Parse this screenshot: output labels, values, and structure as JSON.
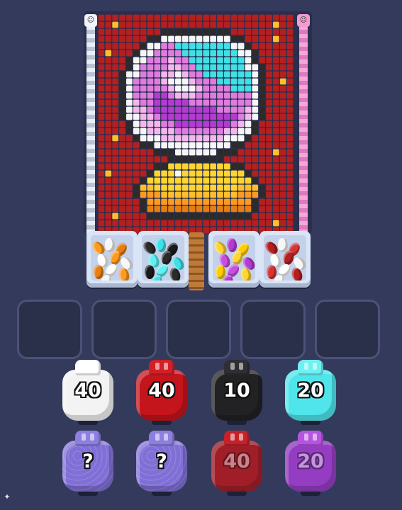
{
  "colors": {
    "background": "#343a5c",
    "pixel_palette": {
      "R": "#b51f1f",
      "r": "#d83434",
      "K": "#2b2b2b",
      "W": "#f6f6f6",
      "C": "#3fe0e6",
      "P": "#e07be0",
      "M": "#b33bd1",
      "L": "#f4b7ec",
      "Y": "#ffd530",
      "O": "#ff9a20",
      "o": "#e67e12",
      "G": "#ffbe2a"
    }
  },
  "pixel_art": {
    "cols": 28,
    "rows": 31,
    "grid": [
      "RRRRRRRRRRRRRRRRRRRRRRRRRRRR",
      "RRGRRRRRRRRRRRRRRRRRRRRRRGRR",
      "RRRRRRRRRKKKKKKKKKKRRRRRRRRR",
      "RRRRRRRKKWWWWWWWWWWKKRRRRGRR",
      "RRRRRRKWWPPCCCCCCCCWWKRRRRRR",
      "RGRRRKWWPPPPCCCCCCCCWWKRRRRR",
      "RRRRKWWPPPLPPCCCCCCCCWKRRRRR",
      "RRRRKWPPPPLLPPCCCCCCCWWKRRRR",
      "RRRKWWPPPLLWLPPCCCCCCCWKRRRR",
      "RRRKWPPPPLWWWLPPPCCCCCWKRRGR",
      "RRRKWPPPPPLWWWLPPPPCCCWKRRRR",
      "RRRKWPPPMMPLLLPPPPPPPPWKRRRR",
      "RRRKWLPPMMMMMPPPPPPPPPWKRRRR",
      "RRRKWLLPMMMMMMMMMPPPPLWKRRRR",
      "RRRKWWLLPMMMMMMMMMMMPLWKRRRR",
      "RRRRKWLLLPPMMMMMMMMPLWKRRRRR",
      "RRRRKWWLLLLPPPPPPPLLWWKRRRRR",
      "RRGRRKWWWLLLLLLLLLWWWKRRRRRR",
      "RRRRRRKKWWWWWWWWWWWKKRRRRRRR",
      "RRRRRRRRKKKWWWWWWKKKRRRRRGRR",
      "RRRRRRRRRRKKKKKKKKRRRRRRRRRR",
      "RRRRRRRRKKYYYYYYYYYKKRRRRRRR",
      "RGRRRRRKYYYWYYYYYYYYYKRRRRRR",
      "RRRRRRKYYYYYYYYYYYYYYYKRRRRR",
      "RRRRRKGGYYYYYYYYYYYYGGGKRRRR",
      "RRRRRKOOOGGGGGGGGGGGOOOKRRRR",
      "RRRRRRKOOOOOOOOOOOOOOOKRRRRR",
      "RRRRRRKoooooooooooooooKRRRRR",
      "RRGRRRRKKKKKKKKKKKKKKKRRRRRR",
      "RRRRRRRRRRRRRRRRRRRRRRRRRGRR",
      "RRRRRRRRRRRRRRRRRRRRRRRRRRRR"
    ]
  },
  "bins": [
    {
      "name": "orange-white",
      "colors": [
        "#ff9a20",
        "#f6f6f6",
        "#e67e12",
        "#ffffff"
      ]
    },
    {
      "name": "black-cyan",
      "colors": [
        "#2b2b2b",
        "#3fe0e6",
        "#1a1a1a",
        "#5ff0f0"
      ]
    },
    {
      "name": "yellow-purple",
      "colors": [
        "#ffd530",
        "#b33bd1",
        "#ffcc00",
        "#c84fe0"
      ]
    },
    {
      "name": "red-white",
      "colors": [
        "#b51f1f",
        "#f6f6f6",
        "#d83434",
        "#ffffff"
      ]
    }
  ],
  "slots": [
    {
      "state": "empty"
    },
    {
      "state": "empty"
    },
    {
      "state": "empty"
    },
    {
      "state": "empty"
    },
    {
      "state": "empty"
    }
  ],
  "jars_row1": [
    {
      "label": "40",
      "color": "#f3f3f3",
      "cap": "#ffffff",
      "faded": false
    },
    {
      "label": "40",
      "color": "#c4141c",
      "cap": "#d21f26",
      "faded": false
    },
    {
      "label": "10",
      "color": "#222225",
      "cap": "#2e2e33",
      "faded": false
    },
    {
      "label": "20",
      "color": "#4fe5ea",
      "cap": "#6ff0f2",
      "faded": false
    }
  ],
  "jars_row2": [
    {
      "label": "?",
      "color": "#7f6fd6",
      "cap": "#8d7fe0",
      "faded": false,
      "mystery": true
    },
    {
      "label": "?",
      "color": "#7f6fd6",
      "cap": "#8d7fe0",
      "faded": false,
      "mystery": true
    },
    {
      "label": "40",
      "color": "#b51a1f",
      "cap": "#c42128",
      "faded": true
    },
    {
      "label": "20",
      "color": "#a53ed4",
      "cap": "#b653e0",
      "faded": true
    }
  ],
  "corner_icon": "sparkle-icon"
}
